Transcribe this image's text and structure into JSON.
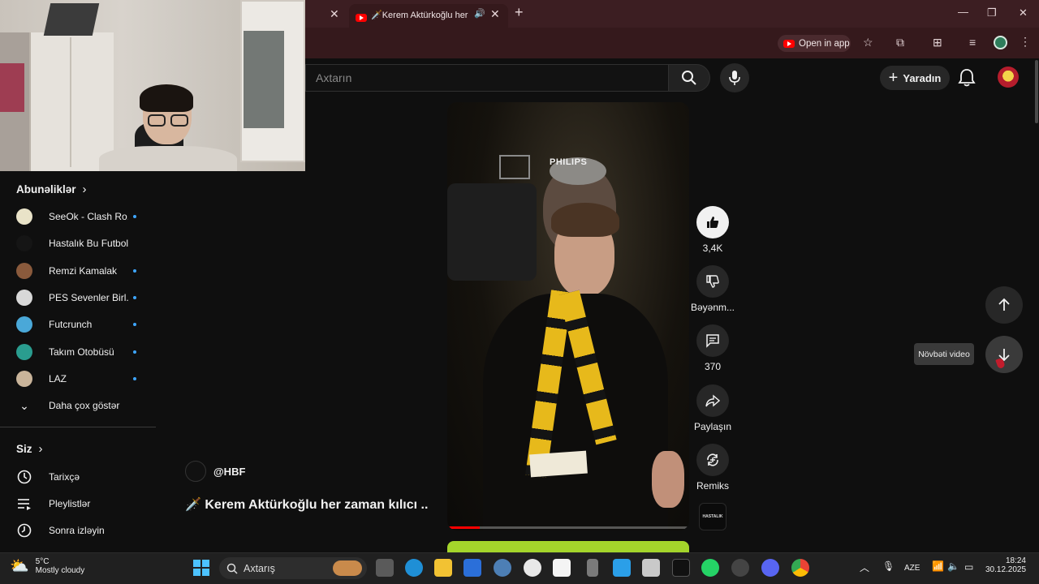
{
  "browser": {
    "active_tab_title": "🗡️Kerem Aktürkoğlu her za",
    "open_in_app_label": "Open in app"
  },
  "header": {
    "search_placeholder": "Axtarın",
    "create_label": "Yaradın"
  },
  "sidebar": {
    "subscriptions_title": "Abunəliklər",
    "subscriptions": [
      {
        "name": "SeeOk - Clash Ro...",
        "color": "#e9e3c8",
        "new": true
      },
      {
        "name": "Hastalık Bu Futbol",
        "color": "#151515",
        "new": false
      },
      {
        "name": "Remzi Kamalak",
        "color": "#8a5a3c",
        "new": true
      },
      {
        "name": "PES Sevenler Birl...",
        "color": "#d8d8d8",
        "new": true
      },
      {
        "name": "Futcrunch",
        "color": "#4aa8d8",
        "new": true
      },
      {
        "name": "Takım Otobüsü",
        "color": "#2a9d8f",
        "new": true
      },
      {
        "name": "LAZ",
        "color": "#c9b49a",
        "new": true
      }
    ],
    "show_more_label": "Daha çox göstər",
    "you_title": "Siz",
    "you_items": [
      {
        "label": "Tarixçə",
        "icon": "history-icon"
      },
      {
        "label": "Pleylistlər",
        "icon": "playlists-icon"
      },
      {
        "label": "Sonra izləyin",
        "icon": "watch-later-icon"
      }
    ]
  },
  "video": {
    "overlay_brand": "PHILIPS",
    "channel_handle": "@HBF",
    "title": "🗡️ Kerem Aktürkoğlu her zaman kılıcı ...",
    "likes": "3,4K",
    "dislike_label": "Bəyənm...",
    "comments": "370",
    "share_label": "Paylaşın",
    "remix_label": "Remiks",
    "channel_badge": "HASTALIK",
    "next_tooltip": "Növbəti video"
  },
  "taskbar": {
    "weather_temp": "5°C",
    "weather_desc": "Mostly cloudy",
    "search_label": "Axtarış",
    "lang": "AZE",
    "time": "18:24",
    "date": "30.12.2025"
  },
  "colors": {
    "tab_bg": "#3c1e22",
    "accent_blue": "#3ea6ff",
    "youtube_red": "#ff0000"
  }
}
